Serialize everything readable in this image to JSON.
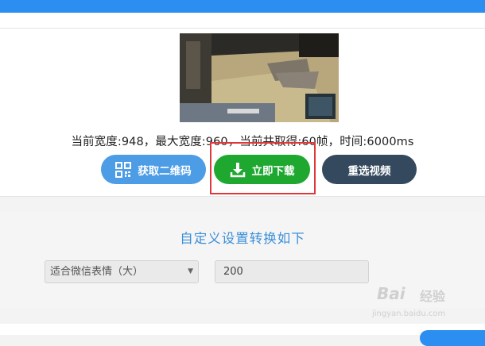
{
  "status": {
    "info_text": "当前宽度:948，最大宽度:960，当前共取得:60帧，时间:6000ms"
  },
  "buttons": {
    "qr_label": "获取二维码",
    "download_label": "立即下载",
    "reselect_label": "重选视频"
  },
  "settings": {
    "title": "自定义设置转换如下",
    "preset_selected": "适合微信表情（大）",
    "size_value": "200"
  },
  "watermark": {
    "logo": "Bai",
    "text": "经验",
    "url": "jingyan.baidu.com"
  },
  "colors": {
    "accent": "#2b8ef0",
    "download_button": "#1ea830",
    "qr_button": "#4d9ce6",
    "reselect_button": "#34495e",
    "highlight": "#e03838",
    "title_text": "#3a8fd9"
  },
  "icons": {
    "qr": "qr-code-icon",
    "download": "download-icon",
    "select_arrow": "chevron-down-icon"
  }
}
